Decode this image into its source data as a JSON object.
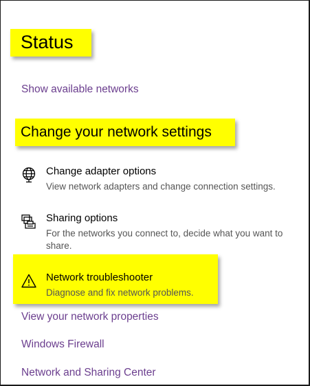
{
  "status": {
    "title": "Status",
    "show_networks_link": "Show available networks"
  },
  "network_settings": {
    "title": "Change your network settings",
    "options": [
      {
        "icon": "globe-icon",
        "title": "Change adapter options",
        "description": "View network adapters and change connection settings."
      },
      {
        "icon": "printer-icon",
        "title": "Sharing options",
        "description": "For the networks you connect to, decide what you want to share."
      },
      {
        "icon": "warning-icon",
        "title": "Network troubleshooter",
        "description": "Diagnose and fix network problems."
      }
    ]
  },
  "links": {
    "view_properties": "View your network properties",
    "windows_firewall": "Windows Firewall",
    "sharing_center": "Network and Sharing Center"
  },
  "colors": {
    "highlight": "#ffff00",
    "link": "#6b3e8e"
  }
}
